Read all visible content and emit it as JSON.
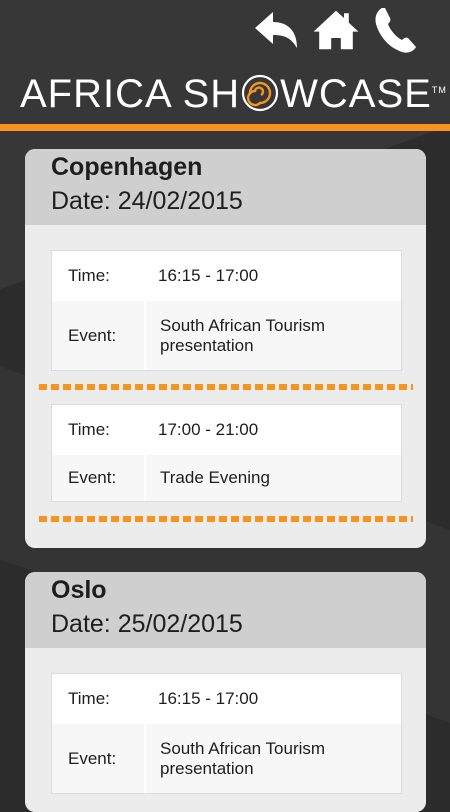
{
  "header": {
    "logo_text": "AFRICA SHOWCASE",
    "logo_left": "AFRICA SH",
    "logo_right": "WCASE",
    "tm": "TM",
    "icons": [
      "back-icon",
      "home-icon",
      "phone-icon"
    ]
  },
  "colors": {
    "accent": "#f7941d",
    "background": "#2c2c2c"
  },
  "events": [
    {
      "city": "Copenhagen",
      "date": "Date: 24/02/2015",
      "items": [
        {
          "time_label": "Time:",
          "time": "16:15 - 17:00",
          "event_label": "Event:",
          "event": "South African Tourism presentation"
        },
        {
          "time_label": "Time:",
          "time": "17:00 - 21:00",
          "event_label": "Event:",
          "event": "Trade Evening"
        }
      ]
    },
    {
      "city": "Oslo",
      "date": "Date: 25/02/2015",
      "items": [
        {
          "time_label": "Time:",
          "time": "16:15 - 17:00",
          "event_label": "Event:",
          "event": "South African Tourism presentation"
        }
      ]
    }
  ]
}
